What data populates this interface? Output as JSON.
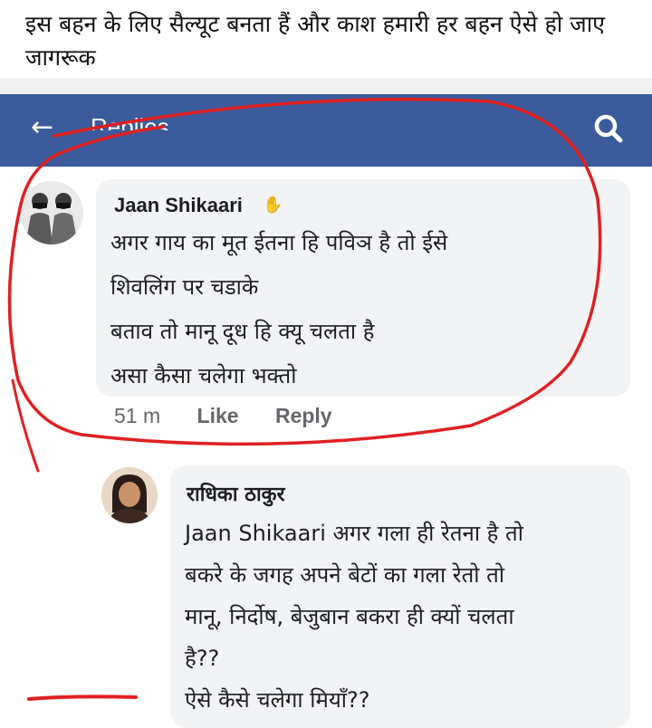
{
  "caption": "इस बहन के लिए सैल्यूट बनता हैं और काश हमारी हर बहन ऐसे हो जाए जागरूक",
  "topbar": {
    "title": "Replies",
    "back_icon": "back-arrow-icon",
    "search_icon": "search-icon",
    "color": "#3b5b9c"
  },
  "comment1": {
    "author": "Jaan Shikaari",
    "lines": [
      "अगर गाय का मूत ईतना हि पविञ है तो ईसे",
      "शिवलिंग पर चडाके",
      "बताव तो मानू दूध हि क्यू चलता है",
      "असा कैसा चलेगा भक्तो"
    ],
    "time": "51 m",
    "like_label": "Like",
    "reply_label": "Reply"
  },
  "comment2": {
    "author": "राधिका ठाकुर",
    "lines": [
      "Jaan Shikaari अगर गला ही रेतना है तो",
      "बकरे के जगह अपने बेटों का गला रेतो तो",
      "मानू, निर्दोष, बेजुबान बकरा ही क्यों चलता",
      "है??",
      "ऐसे कैसे चलेगा मियाँ??"
    ]
  }
}
